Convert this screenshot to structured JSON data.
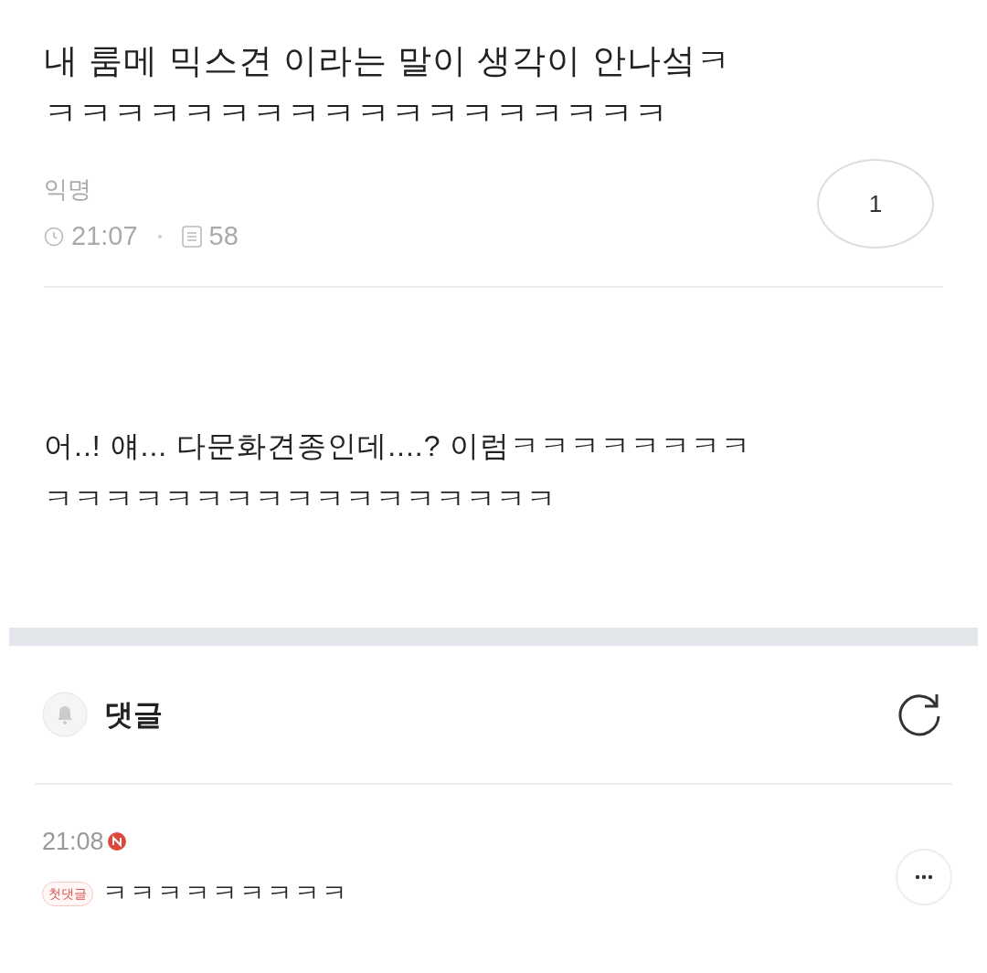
{
  "post": {
    "title_lines": [
      "내 룸메 믹스견 이라는 말이 생각이 안나섴ㅋ",
      "ㅋㅋㅋㅋㅋㅋㅋㅋㅋㅋㅋㅋㅋㅋㅋㅋㅋㅋ"
    ],
    "author": "익명",
    "time": "21:07",
    "views": "58",
    "comment_count": "1",
    "body_lines": [
      "어..! 얘... 다문화견종인데....? 이럼ㅋㅋㅋㅋㅋㅋㅋㅋ",
      "ㅋㅋㅋㅋㅋㅋㅋㅋㅋㅋㅋㅋㅋㅋㅋㅋㅋ"
    ]
  },
  "comments_header": {
    "label": "댓글"
  },
  "comments": [
    {
      "time": "21:08",
      "badge": "첫댓글",
      "text": "ㅋㅋㅋㅋㅋㅋㅋㅋㅋ"
    }
  ]
}
